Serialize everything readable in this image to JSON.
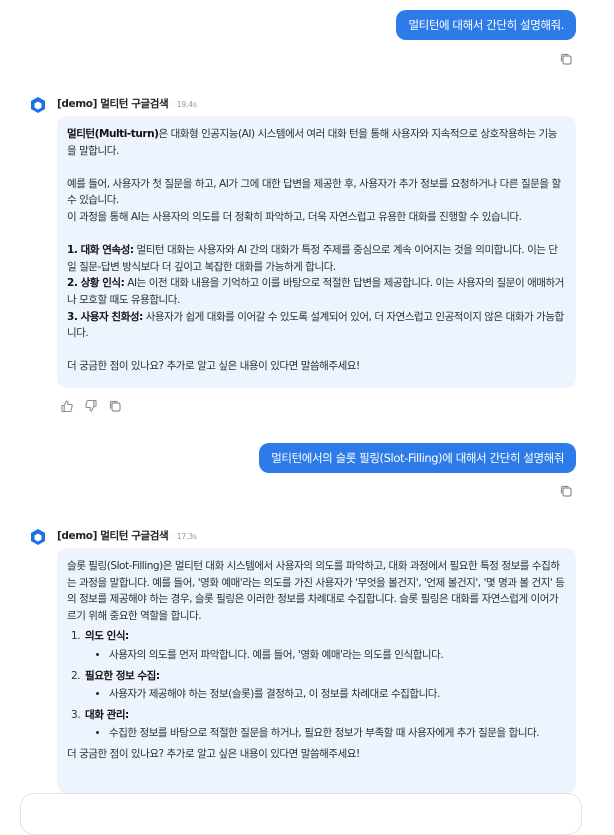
{
  "conversation": {
    "msg1_user": "멀티턴에 대해서 간단히 설명해줘.",
    "msg2_bot": {
      "name": "[demo] 멀티턴 구글검색",
      "time": "· 19.4s",
      "p1_bold": "멀티턴(Multi-turn)",
      "p1_rest": "은 대화형 인공지능(AI) 시스템에서 여러 대화 턴을 통해 사용자와 지속적으로 상호작용하는 기능을 말합니다.",
      "p2": "예를 들어, 사용자가 첫 질문을 하고, AI가 그에 대한 답변을 제공한 후, 사용자가 추가 정보를 요청하거나 다른 질문을 할 수 있습니다.",
      "p3": "이 과정을 통해 AI는 사용자의 의도를 더 정확히 파악하고, 더욱 자연스럽고 유용한 대화를 진행할 수 있습니다.",
      "items": [
        {
          "bold": "1. 대화 연속성:",
          "text": " 멀티턴 대화는 사용자와 AI 간의 대화가 특정 주제를 중심으로 계속 이어지는 것을 의미합니다. 이는 단일 질문-답변 방식보다 더 깊이고 복잡한 대화를 가능하게 합니다."
        },
        {
          "bold": "2. 상황 인식:",
          "text": " AI는 이전 대화 내용을 기억하고 이를 바탕으로 적절한 답변을 제공합니다. 이는 사용자의 질문이 애매하거나 모호할 때도 유용합니다."
        },
        {
          "bold": "3. 사용자 친화성:",
          "text": " 사용자가 쉽게 대화를 이어갈 수 있도록 설계되어 있어, 더 자연스럽고 인공적이지 않은 대화가 가능합니다."
        }
      ],
      "closing": "더 궁금한 점이 있나요? 추가로 알고 싶은 내용이 있다면 말씀해주세요!"
    },
    "msg3_user": "멀티턴에서의 슬롯 필링(Slot-Filling)에 대해서 간단히 설명해줘",
    "msg4_bot": {
      "name": "[demo] 멀티턴 구글검색",
      "time": "· 17.3s",
      "intro": "슬롯 필링(Slot-Filling)은 멀티턴 대화 시스템에서 사용자의 의도를 파악하고, 대화 과정에서 필요한 특정 정보를 수집하는 과정을 말합니다. 예를 들어, '영화 예매'라는 의도를 가진 사용자가 '무엇을 볼건지', '언제 볼건지', '몇 명과 볼 건지' 등의 정보를 제공해야 하는 경우, 슬롯 필링은 이러한 정보를 차례대로 수집합니다. 슬롯 필링은 대화를 자연스럽게 이어가르기 위해 중요한 역할을 합니다.",
      "steps": [
        {
          "title": "의도 인식:",
          "detail": "사용자의 의도를 먼저 파악합니다. 예를 들어, '영화 예매'라는 의도를 인식합니다."
        },
        {
          "title": "필요한 정보 수집:",
          "detail": "사용자가 제공해야 하는 정보(슬롯)를 결정하고, 이 정보를 차례대로 수집합니다."
        },
        {
          "title": "대화 관리:",
          "detail": "수집한 정보를 바탕으로 적절한 질문을 하거나, 필요한 정보가 부족할 때 사용자에게 추가 질문을 합니다."
        }
      ],
      "closing": "더 궁금한 점이 있나요? 추가로 알고 싶은 내용이 있다면 말씀해주세요!"
    }
  },
  "colors": {
    "user_bubble": "#2d7be8",
    "bot_bubble": "#edf4fd",
    "avatar": "#1f6fe5"
  },
  "icons": [
    "copy-icon",
    "thumbs-up-icon",
    "thumbs-down-icon",
    "bot-logo-icon"
  ]
}
